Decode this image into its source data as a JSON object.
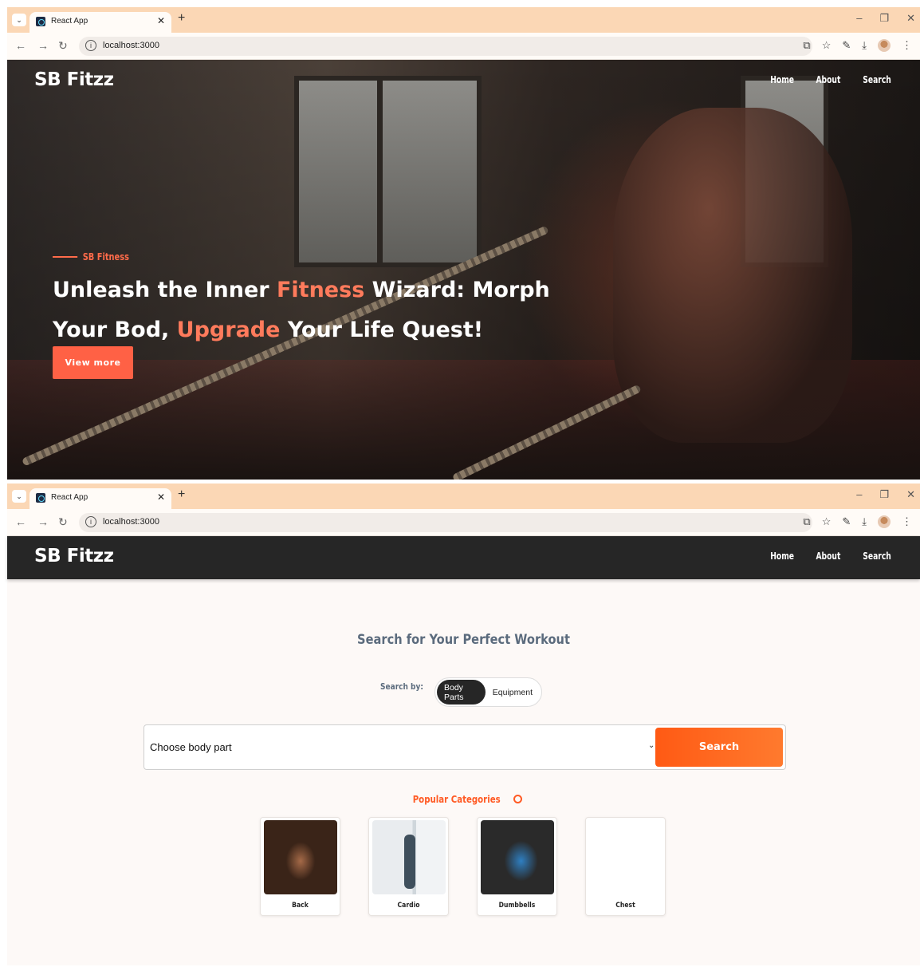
{
  "browser": {
    "tab_title": "React App",
    "url": "localhost:3000"
  },
  "site": {
    "logo": "SB Fitzz",
    "nav": [
      "Home",
      "About",
      "Search"
    ]
  },
  "hero": {
    "eyebrow": "SB Fitness",
    "title_part1": "Unleash the Inner ",
    "title_hl1": "Fitness",
    "title_part2": " Wizard: Morph Your Bod, ",
    "title_hl2": "Upgrade",
    "title_part3": " Your Life Quest!",
    "cta": "View more"
  },
  "search": {
    "title": "Search for Your Perfect Workout",
    "search_by_label": "Search by:",
    "options": [
      "Body Parts",
      "Equipment"
    ],
    "active_option": "Body Parts",
    "select_value": "Choose body part",
    "button": "Search"
  },
  "popular": {
    "title": "Popular Categories",
    "categories": [
      "Back",
      "Cardio",
      "Dumbbells",
      "Chest"
    ]
  },
  "colors": {
    "accent": "#ff6145",
    "search_button": "#ff5a14",
    "navbar": "#262626",
    "tab_bar": "#fbd7b5"
  }
}
